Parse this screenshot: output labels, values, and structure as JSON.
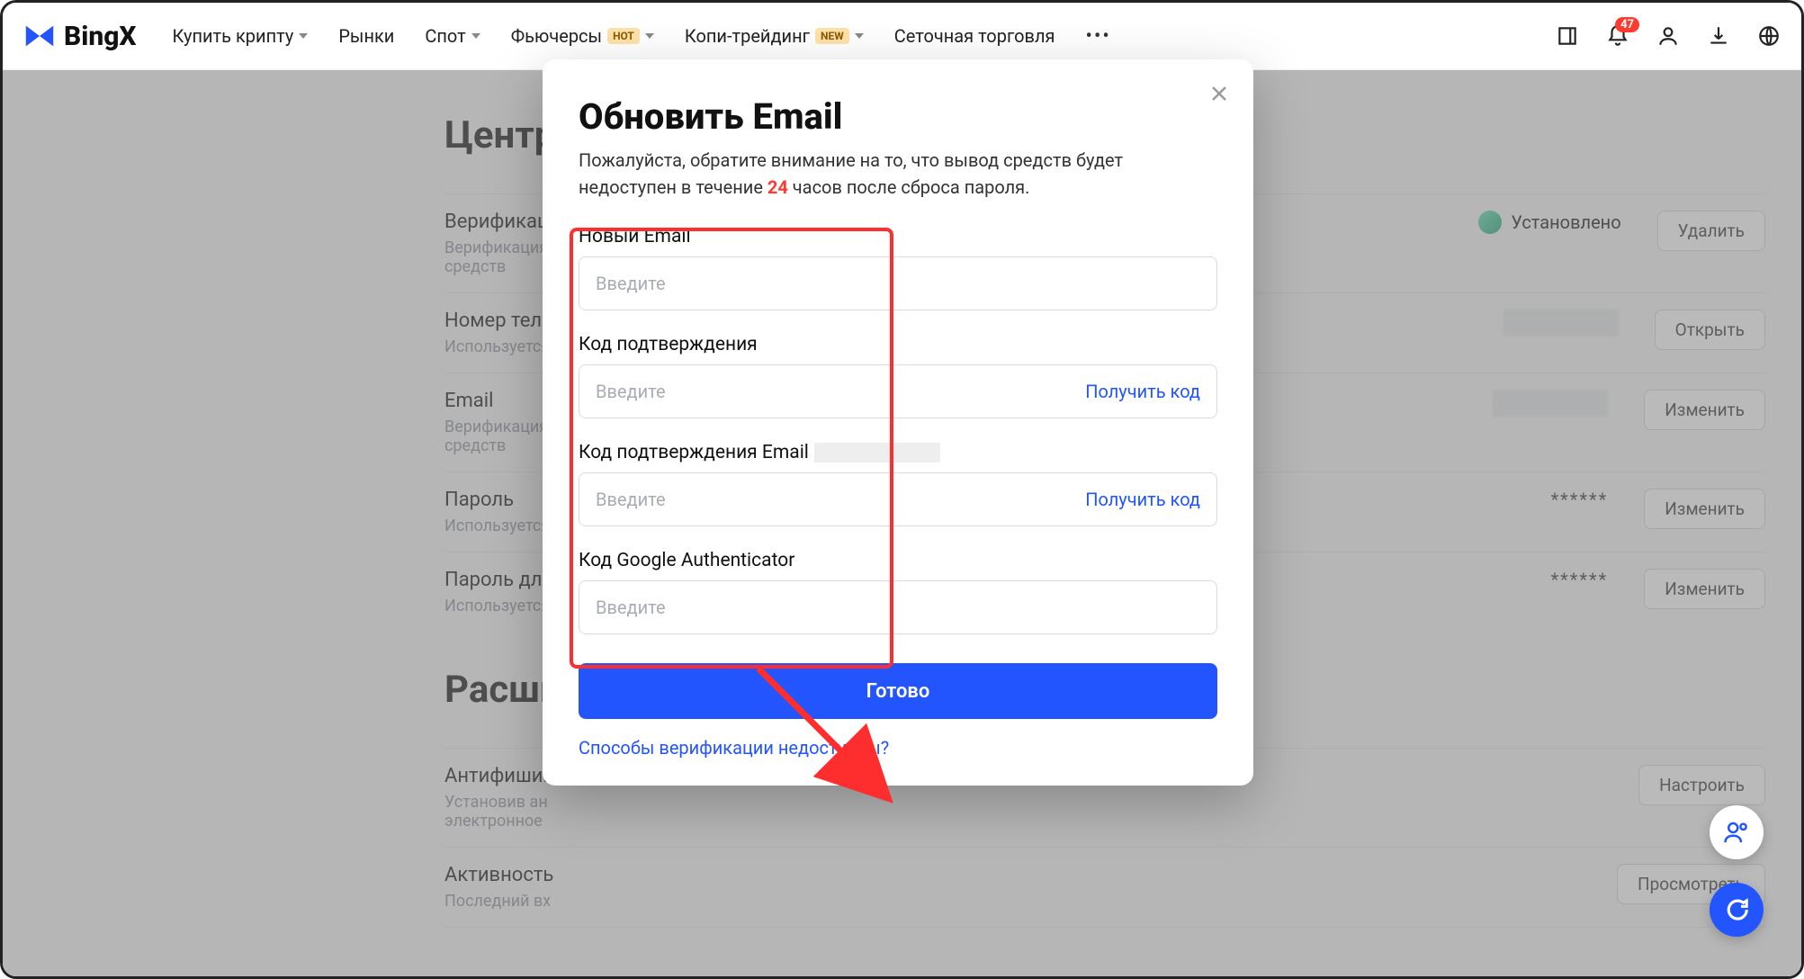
{
  "brand": "BingX",
  "nav": {
    "buy": "Купить крипту",
    "markets": "Рынки",
    "spot": "Спот",
    "futures": "Фьючерсы",
    "futures_tag": "HOT",
    "copy": "Копи-трейдинг",
    "copy_tag": "NEW",
    "grid": "Сеточная торговля"
  },
  "header": {
    "notif_badge": "47"
  },
  "page": {
    "section1_title": "Центр",
    "rows": [
      {
        "title": "Верификация",
        "desc": "Верификация",
        "status": "Установлено",
        "action": "Удалить"
      },
      {
        "title": "Номер теле",
        "desc": "Используется",
        "action": "Открыть"
      },
      {
        "title": "Email",
        "desc": "Верификация",
        "desc2": "средств",
        "action": "Изменить"
      },
      {
        "title": "Пароль",
        "desc": "Используется",
        "mask": "******",
        "action": "Изменить"
      },
      {
        "title": "Пароль для",
        "desc": "Используется",
        "mask": "******",
        "action": "Изменить"
      }
    ],
    "section2_title": "Расшир",
    "rows2": [
      {
        "title": "Антифишин",
        "desc": "Установив ан",
        "desc2": "электронное",
        "action": "Настроить"
      },
      {
        "title": "Активность",
        "desc": "Последний вх",
        "action": "Просмотреть"
      }
    ]
  },
  "modal": {
    "title": "Обновить Email",
    "sub_pre": "Пожалуйста, обратите внимание на то, что вывод средств будет недоступен в течение ",
    "sub_hl": "24",
    "sub_post": " часов после сброса пароля.",
    "f_new_email": "Новый Email",
    "f_code": "Код подтверждения",
    "f_code_email": "Код подтверждения Email",
    "f_ga": "Код Google Authenticator",
    "ph": "Введите",
    "get_code": "Получить код",
    "submit": "Готово",
    "help": "Способы верификации недоступны?"
  }
}
